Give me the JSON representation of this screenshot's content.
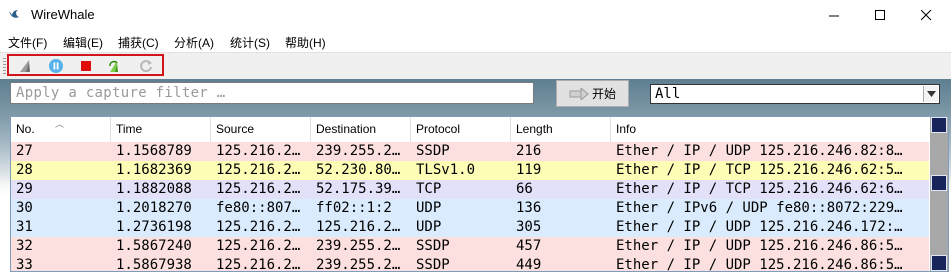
{
  "window": {
    "title": "WireWhale"
  },
  "menu": [
    "文件(F)",
    "编辑(E)",
    "捕获(C)",
    "分析(A)",
    "统计(S)",
    "帮助(H)"
  ],
  "toolbar": {
    "buttons": [
      "shark-fin-icon",
      "pause-icon",
      "stop-icon",
      "restart-icon",
      "refresh-icon"
    ],
    "highlight_color": "#d4141b"
  },
  "filter": {
    "placeholder": "Apply a capture filter …",
    "start_label": "开始",
    "interface_value": "All"
  },
  "packets": {
    "columns": [
      "No.",
      "Time",
      "Source",
      "Destination",
      "Protocol",
      "Length",
      "Info"
    ],
    "rows": [
      {
        "no": "27",
        "time": "1.1568789",
        "src": "125.216.2…",
        "dst": "239.255.2…",
        "proto": "SSDP",
        "len": "216",
        "info": "Ether / IP / UDP 125.216.246.82:8…",
        "color": "#fce0e0"
      },
      {
        "no": "28",
        "time": "1.1682369",
        "src": "125.216.2…",
        "dst": "52.230.80…",
        "proto": "TLSv1.0",
        "len": "119",
        "info": "Ether / IP / TCP 125.216.246.62:5…",
        "color": "#fdfdb6"
      },
      {
        "no": "29",
        "time": "1.1882088",
        "src": "125.216.2…",
        "dst": "52.175.39…",
        "proto": "TCP",
        "len": "66",
        "info": "Ether / IP / TCP 125.216.246.62:6…",
        "color": "#e3e0fa"
      },
      {
        "no": "30",
        "time": "1.2018270",
        "src": "fe80::807…",
        "dst": "ff02::1:2",
        "proto": "UDP",
        "len": "136",
        "info": "Ether / IPv6 / UDP fe80::8072:229…",
        "color": "#d9ebfc"
      },
      {
        "no": "31",
        "time": "1.2736198",
        "src": "125.216.2…",
        "dst": "125.216.2…",
        "proto": "UDP",
        "len": "305",
        "info": "Ether / IP / UDP 125.216.246.172:…",
        "color": "#d9ebfc"
      },
      {
        "no": "32",
        "time": "1.5867240",
        "src": "125.216.2…",
        "dst": "239.255.2…",
        "proto": "SSDP",
        "len": "457",
        "info": "Ether / IP / UDP 125.216.246.86:5…",
        "color": "#fce0e0"
      },
      {
        "no": "33",
        "time": "1.5867938",
        "src": "125.216.2…",
        "dst": "239.255.2…",
        "proto": "SSDP",
        "len": "449",
        "info": "Ether / IP / UDP 125.216.246.86:5…",
        "color": "#fce0e0"
      }
    ]
  }
}
